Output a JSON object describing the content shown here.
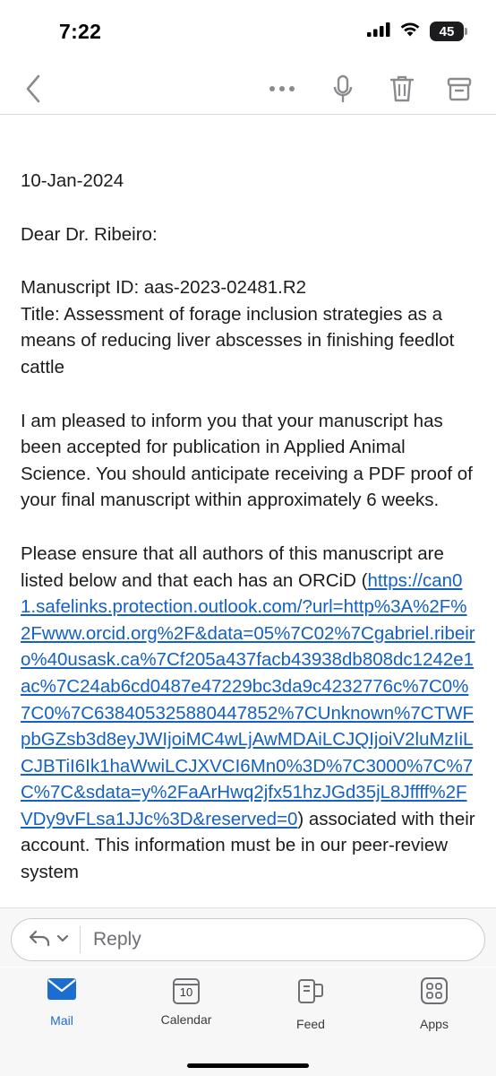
{
  "status_bar": {
    "time": "7:22",
    "battery": "45"
  },
  "toolbar": {
    "back": "back",
    "more": "more",
    "dictate": "dictate",
    "delete": "delete",
    "archive": "archive"
  },
  "email": {
    "date": "10-Jan-2024",
    "greeting": "Dear Dr. Ribeiro:",
    "manuscript_id": "Manuscript ID: aas-2023-02481.R2",
    "title": "Title: Assessment of forage inclusion strategies as a means of reducing liver abscesses in finishing feedlot cattle",
    "para1": "I am pleased to inform you that your manuscript has been accepted for publication in Applied Animal Science.  You should anticipate receiving a PDF proof of your final manuscript within approximately 6 weeks.",
    "para2_start": "Please ensure that all authors of this manuscript are listed below and that each has an ORCiD (",
    "link": "https://can01.safelinks.protection.outlook.com/?url=http%3A%2F%2Fwww.orcid.org%2F&data=05%7C02%7Cgabriel.ribeiro%40usask.ca%7Cf205a437facb43938db808dc1242e1ac%7C24ab6cd0487e47229bc3da9c4232776c%7C0%7C0%7C638405325880447852%7CUnknown%7CTWFpbGZsb3d8eyJWIjoiMC4wLjAwMDAiLCJQIjoiV2luMzIiLCJBTiI6Ik1haWwiLCJXVCI6Mn0%3D%7C3000%7C%7C%7C&sdata=y%2FaArHwq2jfx51hzJGd35jL8Jffff%2FVDy9vFLsa1JJc%3D&reserved=0",
    "para2_end": ") associated with their account. This information must be in our peer-review system"
  },
  "reply": {
    "label": "Reply"
  },
  "tabs": [
    {
      "label": "Mail",
      "icon": "mail-icon",
      "active": true
    },
    {
      "label": "Calendar",
      "icon": "calendar-icon",
      "badge": "10"
    },
    {
      "label": "Feed",
      "icon": "feed-icon"
    },
    {
      "label": "Apps",
      "icon": "apps-icon"
    }
  ],
  "colors": {
    "accent": "#1c6dd0",
    "link": "#1461c2",
    "icon_gray": "#6e6e73"
  }
}
